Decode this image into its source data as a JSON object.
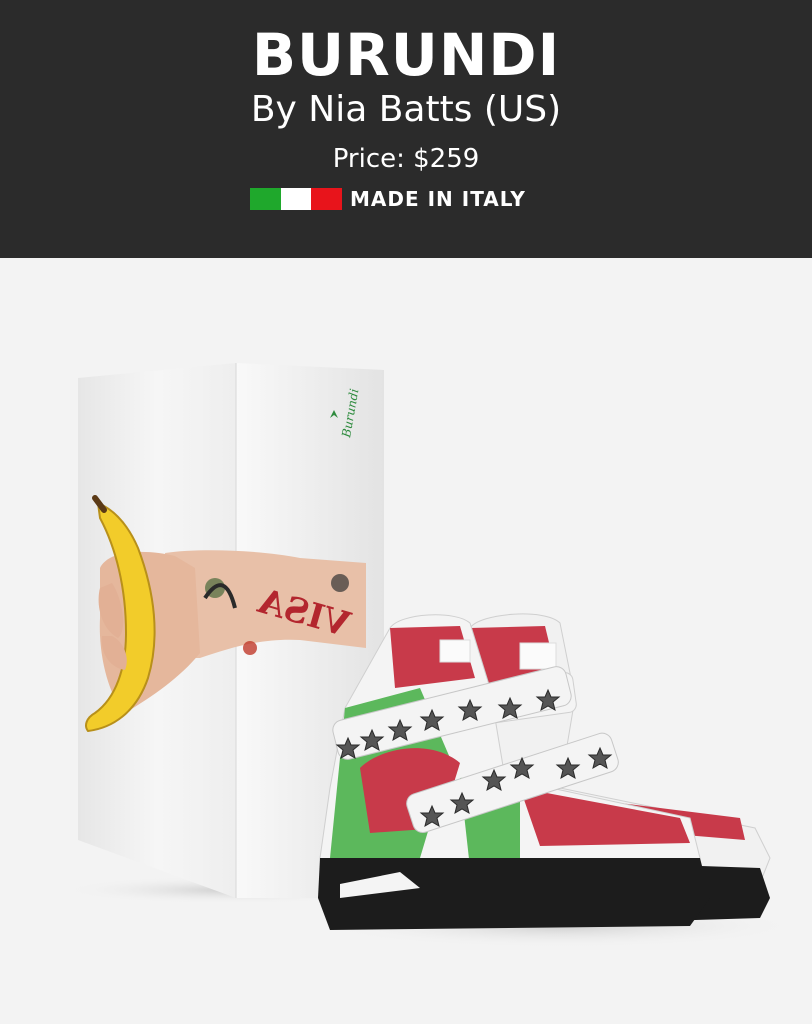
{
  "product": {
    "title": "BURUNDI",
    "designer": "By Nia Batts (US)",
    "price": "Price: $259",
    "origin": "MADE IN ITALY"
  },
  "flag_colors": [
    "#1fa82c",
    "#ffffff",
    "#e8141b"
  ],
  "box": {
    "brand_label": "Burundi",
    "tattoo_text": "VISA"
  },
  "shoe_colors": {
    "red": "#c83a4a",
    "green": "#5cb85c",
    "white": "#f4f4f4",
    "sole": "#1c1c1c"
  }
}
